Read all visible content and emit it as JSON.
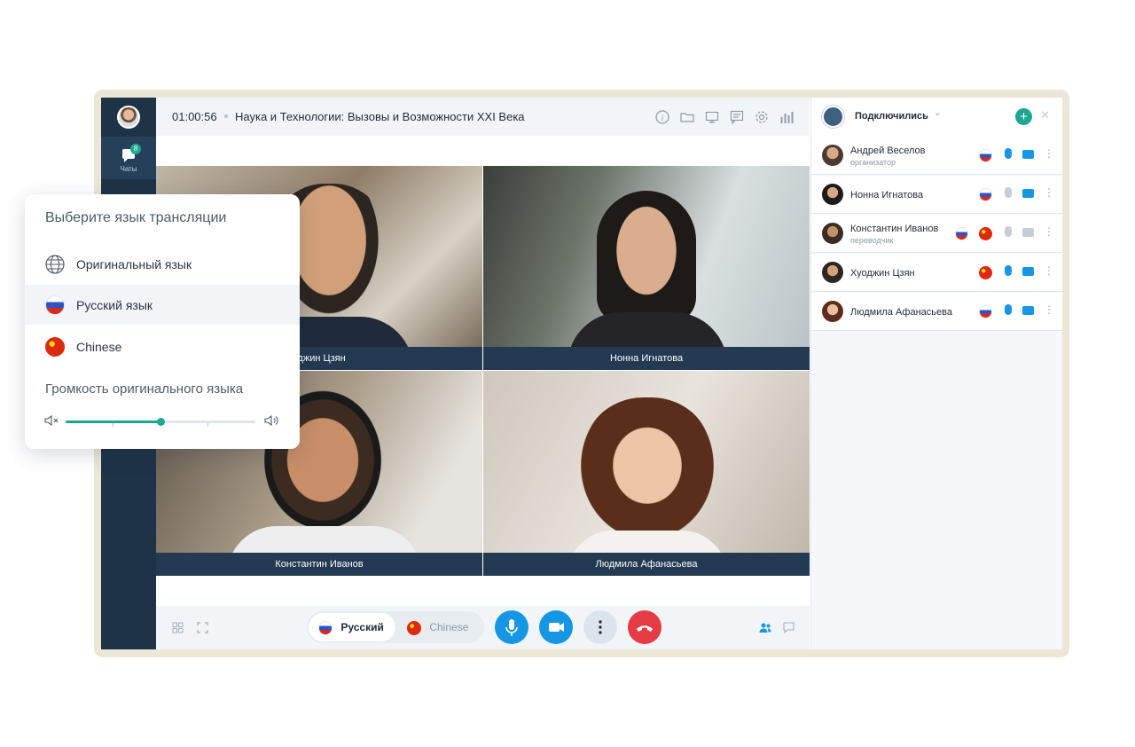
{
  "session": {
    "timer": "01:00:56",
    "title": "Наука и Технологии: Вызовы и Возможности XXI Века"
  },
  "rail": {
    "chats_label": "Чаты",
    "chats_badge": "8"
  },
  "toolbar_icons": [
    "info-icon",
    "folder-icon",
    "screen-share-icon",
    "notes-icon",
    "gear-icon",
    "stats-icon"
  ],
  "video_tiles": [
    {
      "name": "Худжин Цзян",
      "shown": "уджин Цзян"
    },
    {
      "name": "Нонна Игнатова"
    },
    {
      "name": "Константин Иванов"
    },
    {
      "name": "Людмила Афанасьева"
    }
  ],
  "controls": {
    "lang_ru": "Русский",
    "lang_cn": "Chinese",
    "colors": {
      "accent": "#1597e5",
      "hangup": "#e53b45",
      "teal": "#1aa890"
    }
  },
  "participants_panel": {
    "title": "Подключились",
    "rows": [
      {
        "name": "Андрей Веселов",
        "role": "организатор",
        "flags": [
          "ru"
        ],
        "mic": "on",
        "cam": "on"
      },
      {
        "name": "Нонна Игнатова",
        "role": "",
        "flags": [
          "ru"
        ],
        "mic": "off",
        "cam": "on"
      },
      {
        "name": "Константин Иванов",
        "role": "переводчик",
        "flags": [
          "ru",
          "cn"
        ],
        "mic": "off",
        "cam": "off"
      },
      {
        "name": "Хуоджин Цзян",
        "role": "",
        "flags": [
          "cn"
        ],
        "mic": "on",
        "cam": "on"
      },
      {
        "name": "Людмила Афанасьева",
        "role": "",
        "flags": [
          "ru"
        ],
        "mic": "on",
        "cam": "on"
      }
    ]
  },
  "language_popover": {
    "title": "Выберите язык трансляции",
    "options": [
      {
        "label": "Оригинальный язык",
        "icon": "globe-icon"
      },
      {
        "label": "Русский язык",
        "icon": "flag-ru-icon",
        "selected": true
      },
      {
        "label": "Chinese",
        "icon": "flag-cn-icon"
      }
    ],
    "volume_title": "Громкость оригинального языка",
    "volume_level": 0.5
  }
}
